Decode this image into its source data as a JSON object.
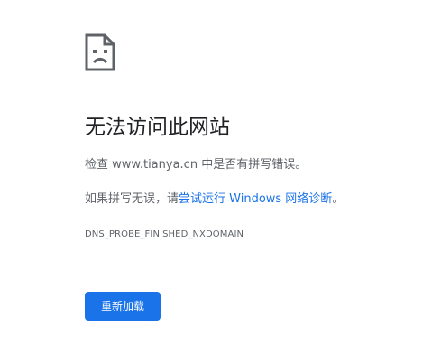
{
  "error": {
    "icon": "sad-page-icon",
    "title": "无法访问此网站",
    "check_prefix": "检查 ",
    "domain": "www.tianya.cn",
    "check_suffix": " 中是否有拼写错误。",
    "suggestion_prefix": "如果拼写无误，请",
    "diagnostics_link": "尝试运行 Windows 网络诊断",
    "suggestion_suffix": "。",
    "code": "DNS_PROBE_FINISHED_NXDOMAIN"
  },
  "actions": {
    "reload_label": "重新加载"
  },
  "colors": {
    "accent": "#1a73e8",
    "text_primary": "#202124",
    "text_secondary": "#5f6368"
  }
}
